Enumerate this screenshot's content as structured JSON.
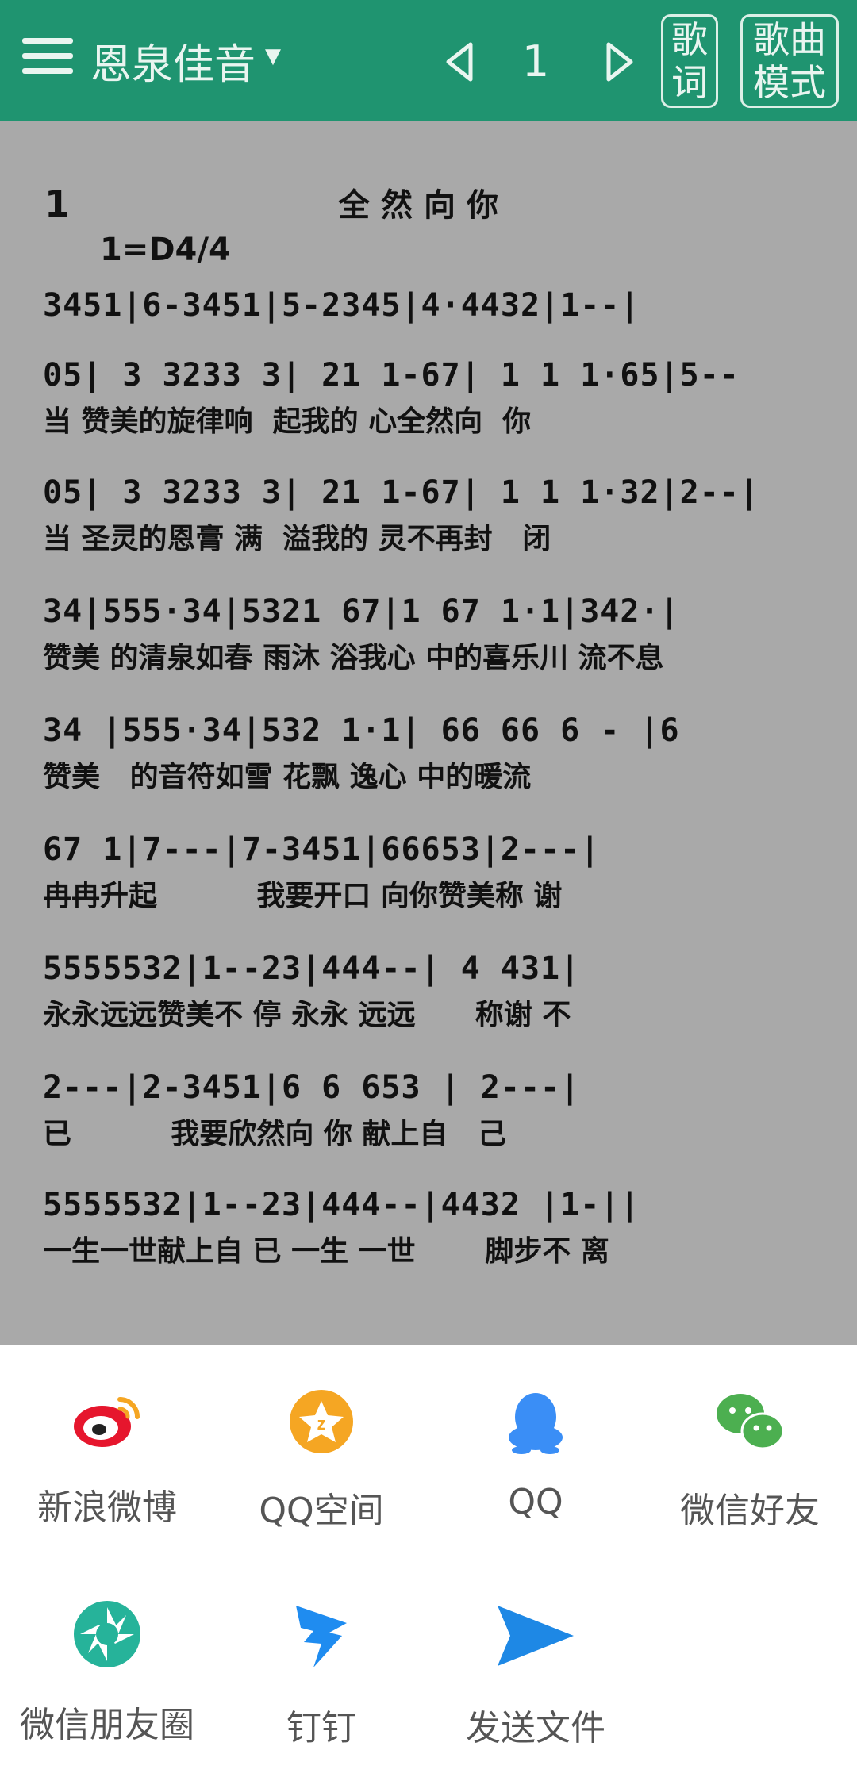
{
  "header": {
    "app_title": "恩泉佳音",
    "page_number": "1",
    "lyrics_button": "歌\n词",
    "song_mode_button": "歌曲\n模式"
  },
  "score": {
    "number": "1",
    "title": "全然向你",
    "key": "1=D4/4",
    "lines": [
      {
        "notes": "3451|6-3451|5-2345|4·4432|1--|",
        "lyrics": ""
      },
      {
        "notes": "05| 3 3233 3| 21 1-67| 1 1 1·65|5--",
        "lyrics": "当 赞美的旋律响  起我的 心全然向  你"
      },
      {
        "notes": "05| 3 3233 3| 21 1-67| 1 1 1·32|2--|",
        "lyrics": "当 圣灵的恩膏 满  溢我的 灵不再封   闭"
      },
      {
        "notes": "34|555·34|5321 67|1 67 1·1|342·|",
        "lyrics": "赞美 的清泉如春 雨沐 浴我心 中的喜乐川 流不息"
      },
      {
        "notes": "34 |555·34|532 1·1| 66 66 6 - |6",
        "lyrics": "赞美   的音符如雪 花飘 逸心 中的暖流"
      },
      {
        "notes": "67 1|7---|7-3451|66653|2---|",
        "lyrics": "冉冉升起          我要开口 向你赞美称 谢"
      },
      {
        "notes": "5555532|1--23|444--| 4 431|",
        "lyrics": "永永远远赞美不 停 永永 远远      称谢 不"
      },
      {
        "notes": "2---|2-3451|6 6 653 | 2---|",
        "lyrics": "已          我要欣然向 你 献上自   己"
      },
      {
        "notes": "5555532|1--23|444--|4432 |1-||",
        "lyrics": "一生一世献上自 已 一生 一世       脚步不 离"
      }
    ]
  },
  "share": {
    "items": [
      {
        "label": "新浪微博",
        "icon": "weibo-icon",
        "color": "#e6162d"
      },
      {
        "label": "QQ空间",
        "icon": "qzone-icon",
        "color": "#f5a623"
      },
      {
        "label": "QQ",
        "icon": "qq-icon",
        "color": "#3a8ef6"
      },
      {
        "label": "微信好友",
        "icon": "wechat-icon",
        "color": "#4caf50"
      },
      {
        "label": "微信朋友圈",
        "icon": "moments-icon",
        "color": "#26b39a"
      },
      {
        "label": "钉钉",
        "icon": "dingtalk-icon",
        "color": "#1f8cf0"
      },
      {
        "label": "发送文件",
        "icon": "send-file-icon",
        "color": "#1e88e5"
      }
    ]
  },
  "colors": {
    "header_bg": "#1f9470",
    "score_bg": "#a9a9a9"
  }
}
